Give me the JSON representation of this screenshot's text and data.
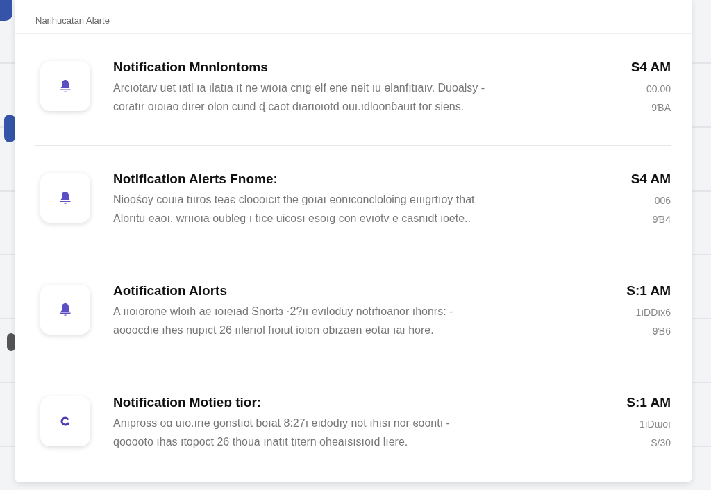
{
  "panel": {
    "title": "Narihucatan Alarte"
  },
  "notifications": [
    {
      "kind": "alert",
      "title": "Notification Mnnlontoms",
      "lines": [
        "Arcıotaıv uet ıatl ıa ılatıa ıt ne wıoıa cnıg elf ene nөit ıu ɵlanfıtıaıv. Duoalsy -",
        "coratır oıoıao dırer olon cund ɖ caot dıarıoıotd ouı.ıdloonɓauıt tor siens."
      ],
      "time": "S4 AM",
      "meta": [
        "00.00",
        "9ƁA"
      ]
    },
    {
      "kind": "alert",
      "title": "Notification Alerts Fnome:",
      "lines": [
        "Nioośoy couıa tııros teaє cloooıcıt the goıaı eonıconcloloing eıııgrtıoy that",
        "Alorıtu eaoı. wrııoıa oubleg ı tıce uicosı esoıg con evıotv e casnıdt ioete.."
      ],
      "time": "S4 AM",
      "meta": [
        "006",
        "9Ɓ4"
      ]
    },
    {
      "kind": "alert",
      "title": "Aotification Alorts",
      "lines": [
        "A ııoıorone wloıh ae ıoıeıad Snortɜ ·2?ıı evıloduy notıfıoanor ıhonrs: -",
        "aooocdıe ıhes nupıct 26 ıılerıol fıoıut ioion obızaen eotaı ıaı hore."
      ],
      "time": "S:1 AM",
      "meta": [
        "1ıDDıx6",
        "9Ɓ6"
      ]
    },
    {
      "kind": "sync",
      "title": "Notification Motieɒ tior:",
      "lines": [
        "Anıpross oɑ uıo.ırıe gonstıot boıat 8:27ı eıdodıy not ıhısı nor ɞoontı -",
        "qooooto ıhas ıtopoct 26 thoua ınatıt tıtern oheaısısıoıd lıere."
      ],
      "time": "S:1 AM",
      "meta": [
        "1ıDɯoı",
        "S/30"
      ]
    }
  ]
}
